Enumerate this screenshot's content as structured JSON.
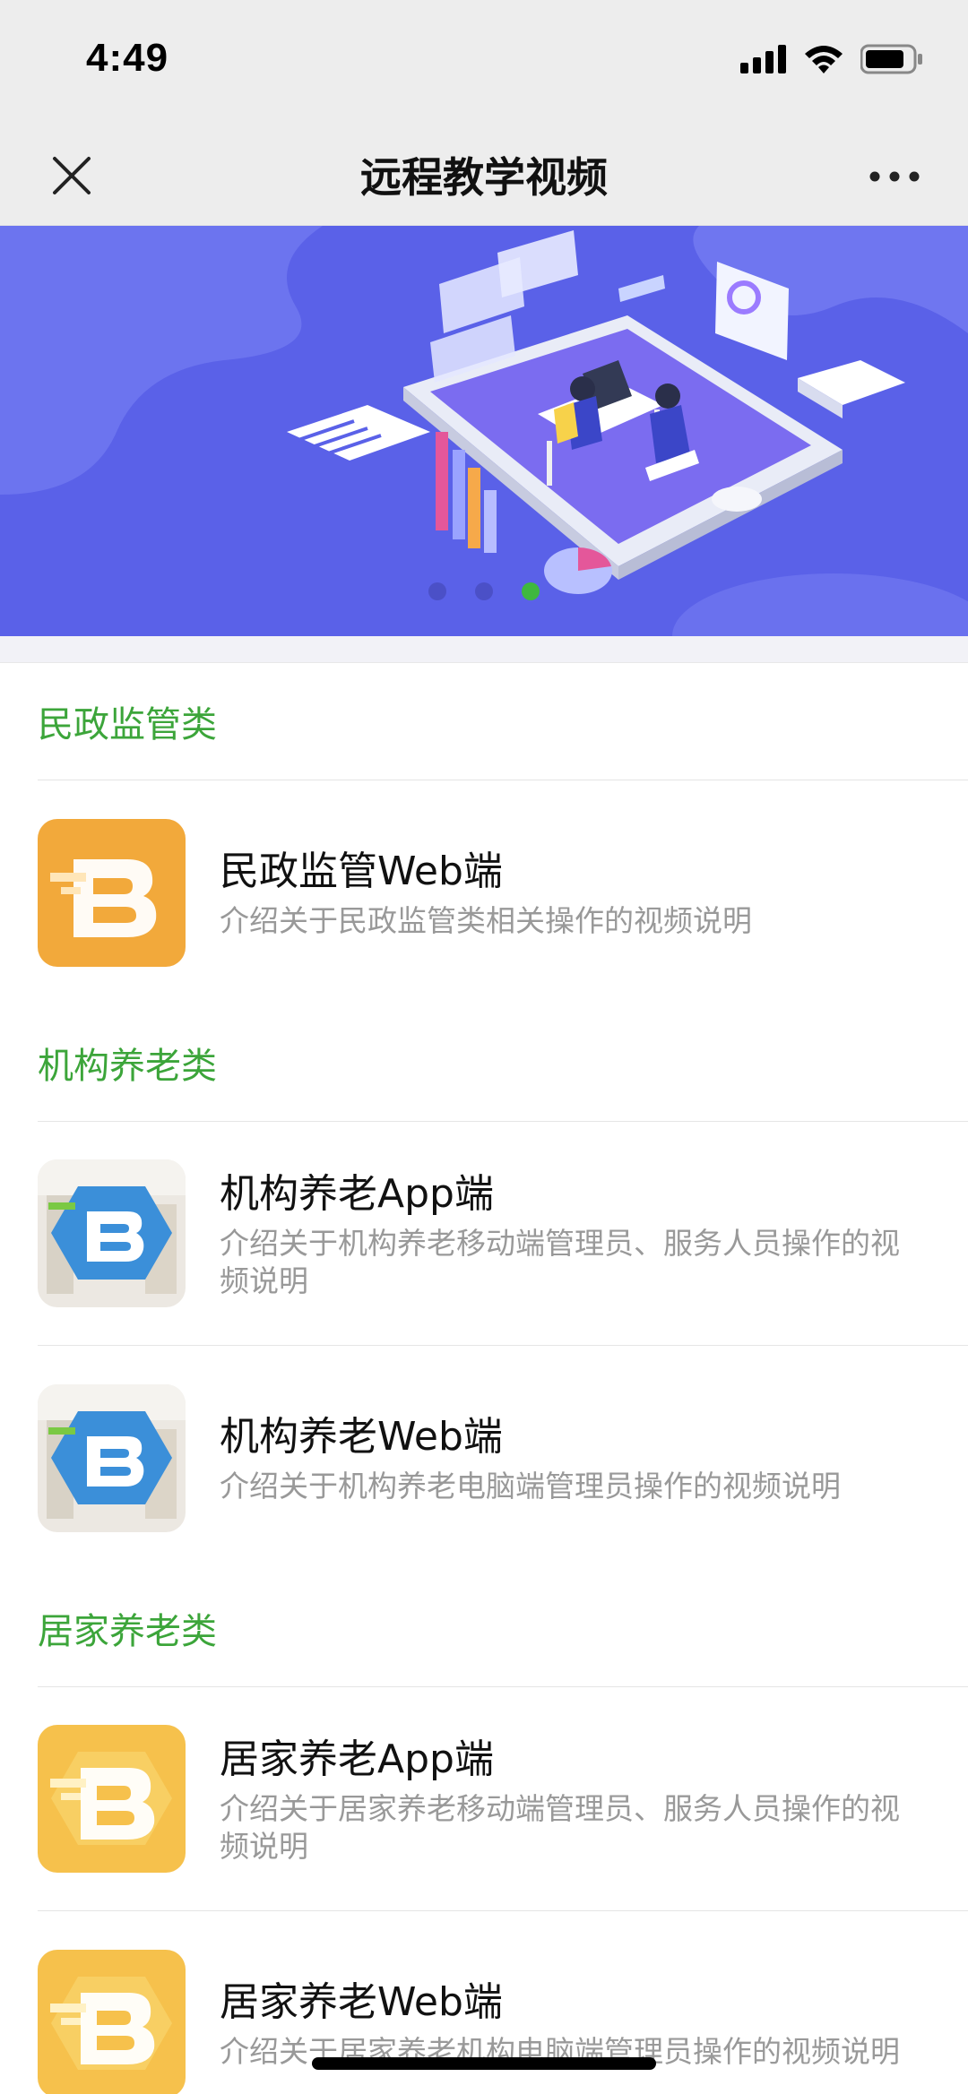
{
  "status": {
    "time": "4:49"
  },
  "nav": {
    "title": "远程教学视频"
  },
  "banner": {
    "dots": 3,
    "active_dot": 2
  },
  "sections": [
    {
      "title": "民政监管类",
      "items": [
        {
          "title": "民政监管Web端",
          "desc": "介绍关于民政监管类相关操作的视频说明",
          "icon_style": "orange"
        }
      ]
    },
    {
      "title": "机构养老类",
      "items": [
        {
          "title": "机构养老App端",
          "desc": "介绍关于机构养老移动端管理员、服务人员操作的视频说明",
          "icon_style": "blue"
        },
        {
          "title": "机构养老Web端",
          "desc": "介绍关于机构养老电脑端管理员操作的视频说明",
          "icon_style": "blue"
        }
      ]
    },
    {
      "title": "居家养老类",
      "items": [
        {
          "title": "居家养老App端",
          "desc": "介绍关于居家养老移动端管理员、服务人员操作的视频说明",
          "icon_style": "yellow"
        },
        {
          "title": "居家养老Web端",
          "desc": "介绍关于居家养老机构电脑端管理员操作的视频说明",
          "icon_style": "yellow"
        }
      ]
    }
  ],
  "colors": {
    "accent_green": "#3ca53a",
    "banner_bg": "#5a61e8",
    "orange_icon": "#f2a93b",
    "yellow_icon": "#f6c14c",
    "blue_icon": "#3b8fd9"
  }
}
